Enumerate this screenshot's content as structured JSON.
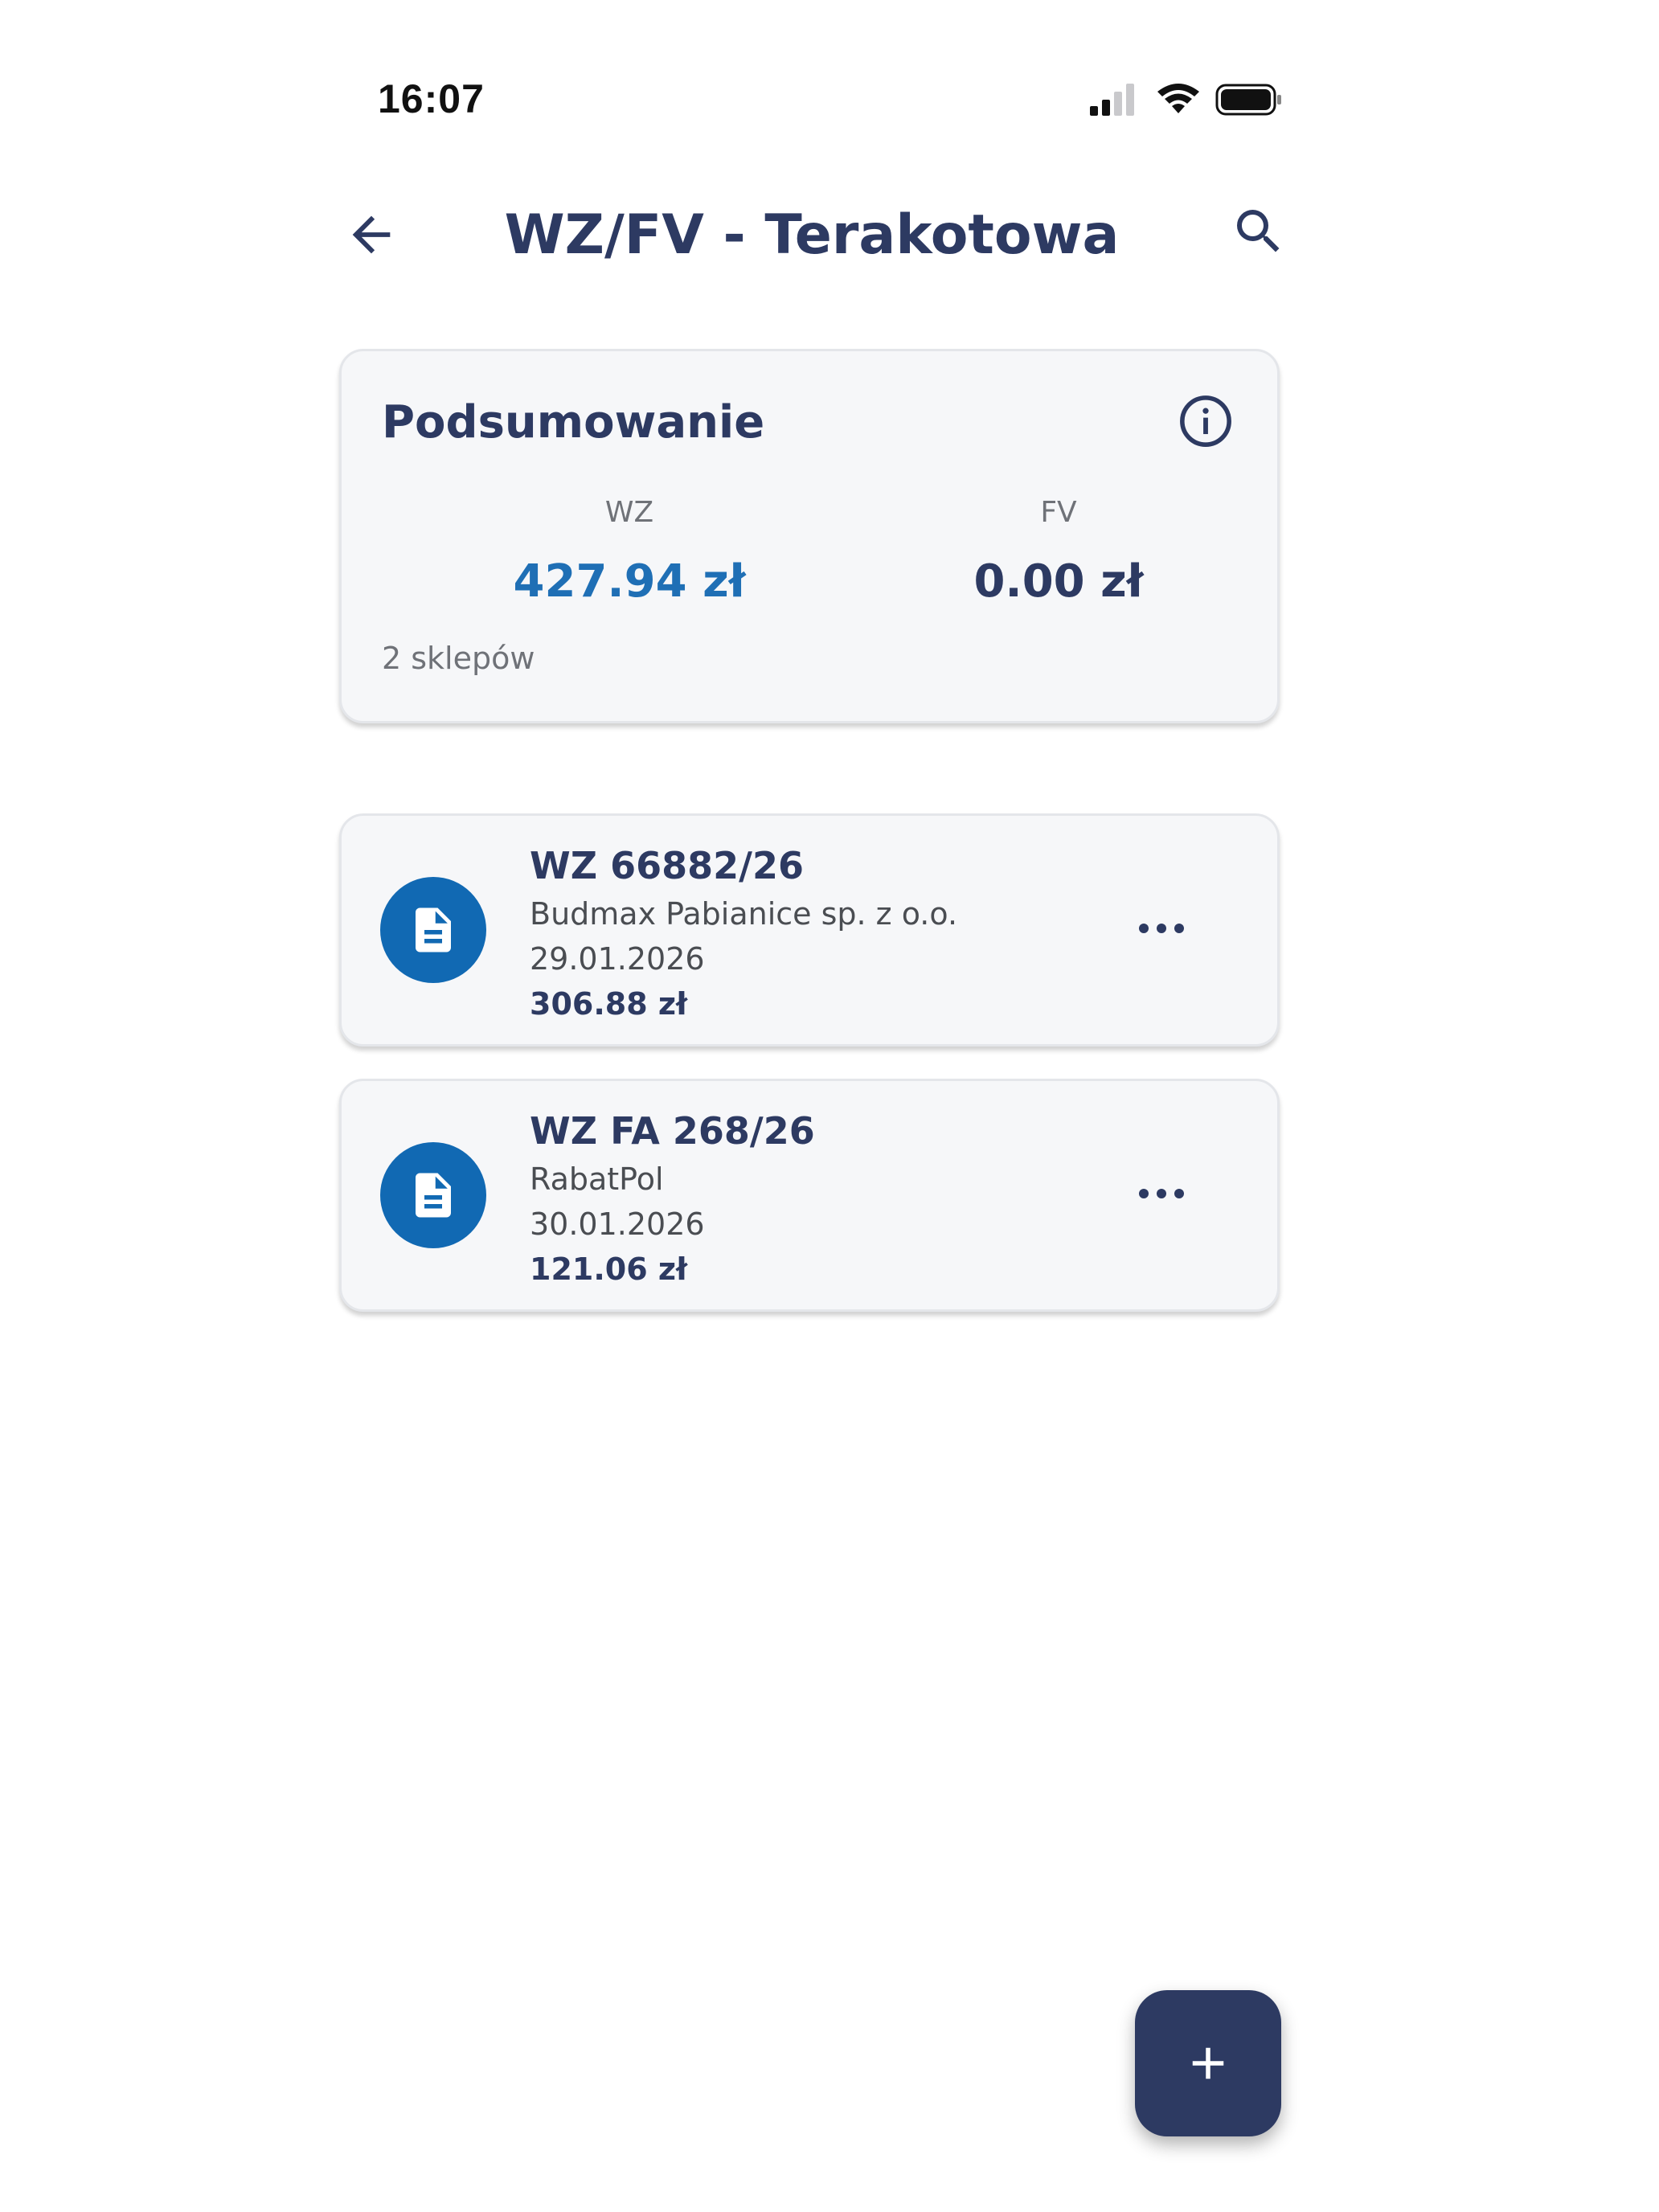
{
  "status_bar": {
    "time": "16:07",
    "icons": [
      "cellular-signal-icon",
      "wifi-icon",
      "battery-icon"
    ]
  },
  "header": {
    "title": "WZ/FV - Terakotowa",
    "back_icon": "arrow-left-icon",
    "search_icon": "search-icon"
  },
  "summary": {
    "title": "Podsumowanie",
    "info_icon": "info-icon",
    "wz_label": "WZ",
    "wz_value": "427.94 zł",
    "fv_label": "FV",
    "fv_value": "0.00 zł",
    "shops_count": "2 sklepów"
  },
  "documents": [
    {
      "number": "WZ 66882/26",
      "company": "Budmax Pabianice sp. z o.o.",
      "date": "29.01.2026",
      "amount": "306.88 zł",
      "icon": "document-icon",
      "menu_icon": "more-horizontal-icon"
    },
    {
      "number": "WZ FA 268/26",
      "company": "RabatPol",
      "date": "30.01.2026",
      "amount": "121.06 zł",
      "icon": "document-icon",
      "menu_icon": "more-horizontal-icon"
    }
  ],
  "fab": {
    "icon": "plus-icon"
  },
  "colors": {
    "primary_dark": "#2d3a62",
    "accent_blue": "#1f6fb5",
    "avatar_blue": "#1169b3",
    "card_background": "#f6f7f9",
    "muted_text": "#6f7278"
  }
}
